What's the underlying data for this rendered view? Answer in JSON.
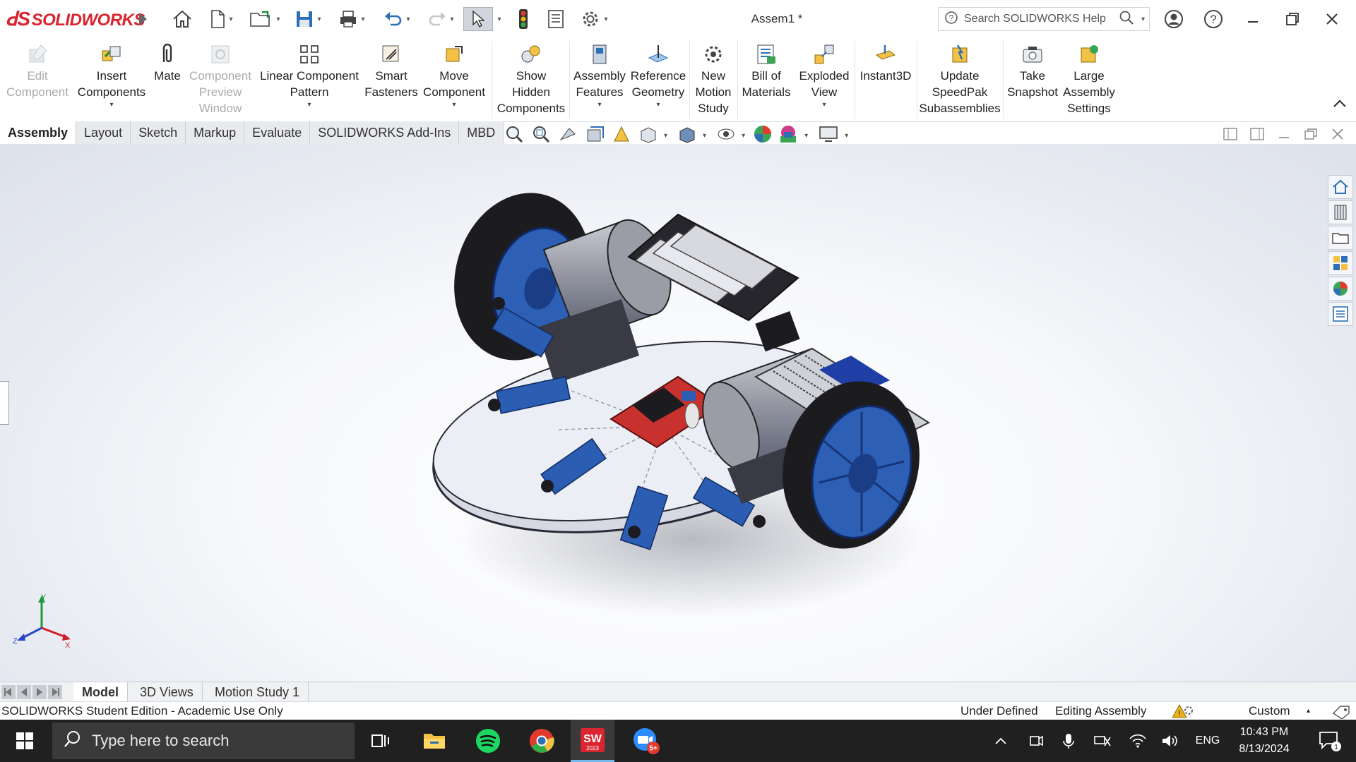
{
  "app": {
    "brand": "SOLIDWORKS",
    "document_title": "Assem1 *",
    "search_placeholder": "Search SOLIDWORKS Help",
    "accent": "#d8252f"
  },
  "ribbon": {
    "edit_component": "Edit\nComponent",
    "insert_components": "Insert\nComponents",
    "mate": "Mate",
    "component_preview": "Component\nPreview\nWindow",
    "linear_pattern": "Linear Component\nPattern",
    "smart_fasteners": "Smart\nFasteners",
    "move_component": "Move\nComponent",
    "show_hidden": "Show\nHidden\nComponents",
    "assembly_features": "Assembly\nFeatures",
    "reference_geometry": "Reference\nGeometry",
    "new_motion_study": "New\nMotion\nStudy",
    "bill_of_materials": "Bill of\nMaterials",
    "exploded_view": "Exploded\nView",
    "instant3d": "Instant3D",
    "update_speedpak": "Update\nSpeedPak\nSubassemblies",
    "take_snapshot": "Take\nSnapshot",
    "large_assembly": "Large\nAssembly\nSettings"
  },
  "tabs": [
    "Assembly",
    "Layout",
    "Sketch",
    "Markup",
    "Evaluate",
    "SOLIDWORKS Add-Ins",
    "MBD"
  ],
  "bottom_tabs": [
    "Model",
    "3D Views",
    "Motion Study 1"
  ],
  "triad": {
    "x": "X",
    "y": "Y",
    "z": "Z"
  },
  "status": {
    "edition": "SOLIDWORKS Student Edition - Academic Use Only",
    "definition": "Under Defined",
    "mode": "Editing Assembly",
    "units": "Custom"
  },
  "taskbar": {
    "search_placeholder": "Type here to search",
    "language": "ENG",
    "time": "10:43 PM",
    "date": "8/13/2024",
    "notification_count": "1",
    "sw_badge": "2023",
    "zoom_badge": "5+"
  }
}
